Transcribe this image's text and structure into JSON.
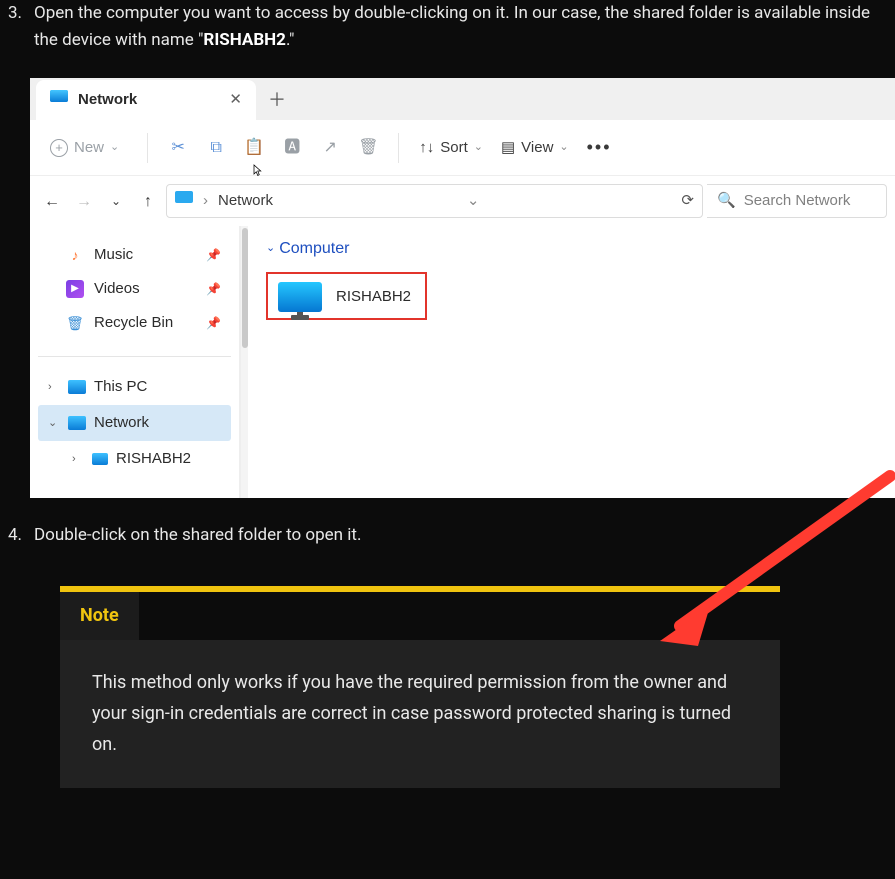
{
  "steps": {
    "s3": {
      "num": "3.",
      "text_a": "Open the computer you want to access by double-clicking on it. In our case, the shared folder is available inside the device with name \"",
      "bold": "RISHABH2",
      "text_b": ".\""
    },
    "s4": {
      "num": "4.",
      "text": "Double-click on the shared folder to open it."
    }
  },
  "win": {
    "tab_title": "Network",
    "new_btn": "New",
    "sort": "Sort",
    "view": "View",
    "breadcrumb": "Network",
    "search_placeholder": "Search Network",
    "quick": [
      {
        "label": "Music"
      },
      {
        "label": "Videos"
      },
      {
        "label": "Recycle Bin"
      }
    ],
    "tree": {
      "this_pc": "This PC",
      "network": "Network",
      "child": "RISHABH2"
    },
    "group_header": "Computer",
    "node_label": "RISHABH2"
  },
  "note": {
    "title": "Note",
    "body": "This method only works if you have the required permission from the owner and your sign-in credentials are correct in case password protected sharing is turned on."
  }
}
